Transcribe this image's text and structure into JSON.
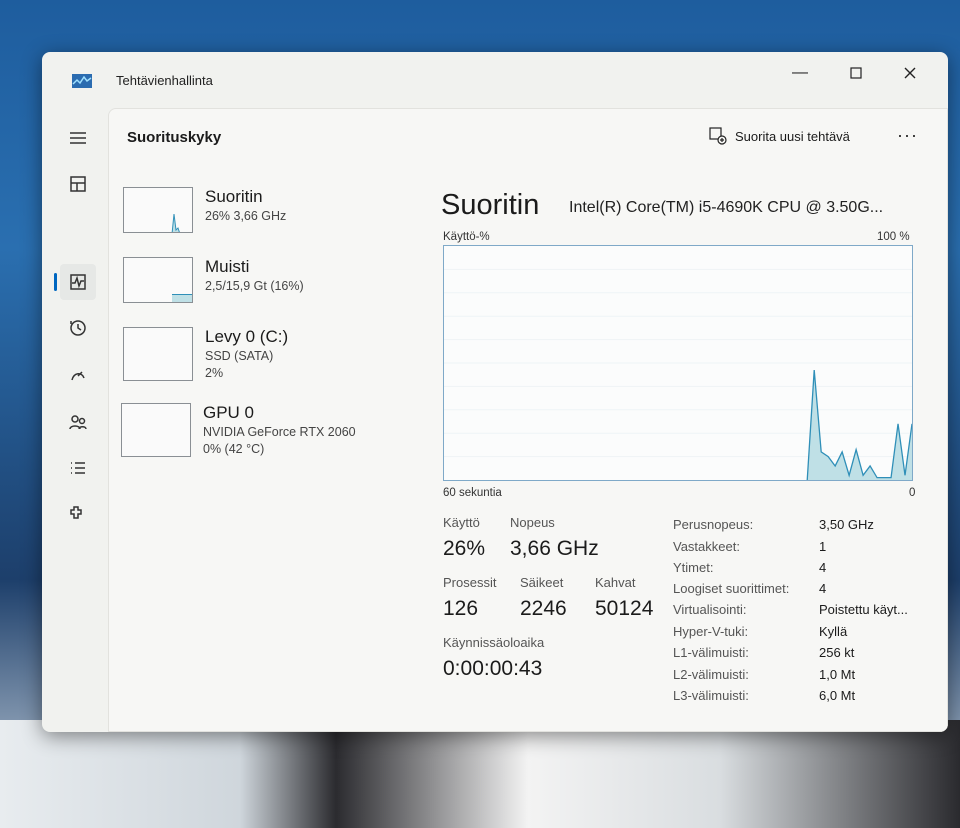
{
  "window": {
    "title": "Tehtävienhallinta"
  },
  "header": {
    "page_title": "Suorituskyky",
    "run_task_label": "Suorita uusi tehtävä",
    "more_label": "···"
  },
  "sidebar": {
    "items": [
      "menu-icon",
      "processes-icon",
      "performance-icon",
      "app-history-icon",
      "startup-icon",
      "users-icon",
      "details-icon",
      "services-icon"
    ]
  },
  "perf_list": [
    {
      "name": "Suoritin",
      "line1": "26% 3,66 GHz",
      "line2": ""
    },
    {
      "name": "Muisti",
      "line1": "2,5/15,9 Gt (16%)",
      "line2": ""
    },
    {
      "name": "Levy 0 (C:)",
      "line1": "SSD (SATA)",
      "line2": "2%"
    },
    {
      "name": "GPU 0",
      "line1": "NVIDIA GeForce RTX 2060",
      "line2": "0% (42 °C)"
    }
  ],
  "detail": {
    "title": "Suoritin",
    "cpu_name": "Intel(R) Core(TM) i5-4690K CPU @ 3.50G...",
    "graph_top_left": "Käyttö-%",
    "graph_top_right": "100 %",
    "graph_bottom_left": "60 sekuntia",
    "graph_bottom_right": "0",
    "cpu_history": [
      0,
      0,
      0,
      0,
      0,
      0,
      0,
      0,
      0,
      0,
      0,
      0,
      0,
      0,
      0,
      0,
      0,
      0,
      0,
      0,
      0,
      0,
      0,
      0,
      0,
      0,
      0,
      0,
      0,
      0,
      0,
      0,
      0,
      0,
      0,
      0,
      0,
      0,
      0,
      0,
      0,
      0,
      0,
      0,
      0,
      0,
      0,
      0,
      0,
      0,
      0,
      0,
      0,
      47,
      12,
      10,
      6,
      12,
      2,
      13,
      2,
      6,
      1,
      1,
      1,
      24,
      2,
      24
    ]
  },
  "stats": {
    "usage_label": "Käyttö",
    "usage_value": "26%",
    "speed_label": "Nopeus",
    "speed_value": "3,66 GHz",
    "processes_label": "Prosessit",
    "processes_value": "126",
    "threads_label": "Säikeet",
    "threads_value": "2246",
    "handles_label": "Kahvat",
    "handles_value": "50124",
    "uptime_label": "Käynnissäoloaika",
    "uptime_value": "0:00:00:43"
  },
  "specs": [
    {
      "label": "Perusnopeus:",
      "value": "3,50 GHz"
    },
    {
      "label": "Vastakkeet:",
      "value": "1"
    },
    {
      "label": "Ytimet:",
      "value": "4"
    },
    {
      "label": "Loogiset suoritti­met:",
      "value": "4"
    },
    {
      "label": "Virtualisointi:",
      "value": "Poistettu käyt..."
    },
    {
      "label": "Hyper-V-tuki:",
      "value": "Kyllä"
    },
    {
      "label": "L1-välimuisti:",
      "value": "256 kt"
    },
    {
      "label": "L2-välimuisti:",
      "value": "1,0 Mt"
    },
    {
      "label": "L3-välimuisti:",
      "value": "6,0 Mt"
    }
  ],
  "colors": {
    "accent": "#0067c0",
    "graph_line": "#2f8fb8",
    "graph_fill": "#bfe0e6"
  }
}
